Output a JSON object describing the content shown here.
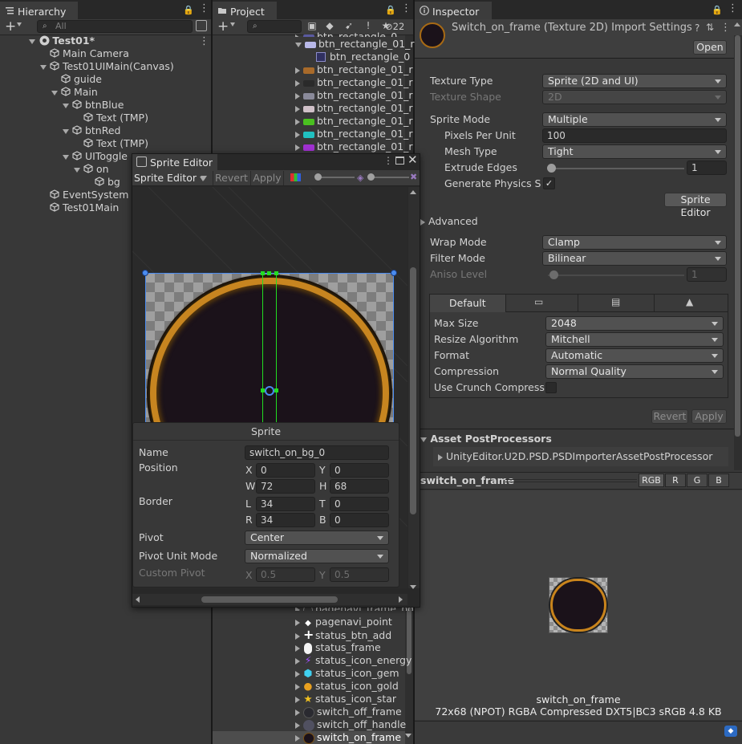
{
  "hierarchy": {
    "tab_label": "Hierarchy",
    "search_placeholder": "All",
    "items": [
      {
        "label": "Test01*"
      },
      {
        "label": "Main Camera"
      },
      {
        "label": "Test01UIMain(Canvas)"
      },
      {
        "label": "guide"
      },
      {
        "label": "Main"
      },
      {
        "label": "btnBlue"
      },
      {
        "label": "Text (TMP)"
      },
      {
        "label": "btnRed"
      },
      {
        "label": "Text (TMP)"
      },
      {
        "label": "UIToggle"
      },
      {
        "label": "on"
      },
      {
        "label": "bg"
      },
      {
        "label": "EventSystem"
      },
      {
        "label": "Test01Main"
      }
    ]
  },
  "project": {
    "tab_label": "Project",
    "hidden_count": "22",
    "top_items": [
      {
        "label": "btn_rectangle_0",
        "color": "#5a5aa0"
      },
      {
        "label": "btn_rectangle_01_r",
        "color": "#b8b8e8"
      },
      {
        "label": "btn_rectangle_0",
        "color": "#8080c0"
      },
      {
        "label": "btn_rectangle_01_r",
        "color": "#a86a2a"
      },
      {
        "label": "btn_rectangle_01_r",
        "color": "#2a2a2a"
      },
      {
        "label": "btn_rectangle_01_r",
        "color": "#8a8a9a"
      },
      {
        "label": "btn_rectangle_01_r",
        "color": "#d0c0c8"
      },
      {
        "label": "btn_rectangle_01_r",
        "color": "#4ac020"
      },
      {
        "label": "btn_rectangle_01_r",
        "color": "#20c0c0"
      },
      {
        "label": "btn_rectangle_01_r",
        "color": "#a030d0"
      }
    ],
    "bottom_items": [
      {
        "label": "pagenavi_frame_ng"
      },
      {
        "label": "pagenavi_point"
      },
      {
        "label": "status_btn_add"
      },
      {
        "label": "status_frame"
      },
      {
        "label": "status_icon_energy"
      },
      {
        "label": "status_icon_gem"
      },
      {
        "label": "status_icon_gold"
      },
      {
        "label": "status_icon_star"
      },
      {
        "label": "switch_off_frame"
      },
      {
        "label": "switch_off_handle"
      },
      {
        "label": "switch_on_frame"
      }
    ]
  },
  "sprite_editor": {
    "title": "Sprite Editor",
    "mode_label": "Sprite Editor",
    "revert": "Revert",
    "apply": "Apply",
    "sprite_panel": {
      "header": "Sprite",
      "name_label": "Name",
      "name_value": "switch_on_bg_0",
      "position_label": "Position",
      "x_label": "X",
      "x_value": "0",
      "y_label": "Y",
      "y_value": "0",
      "w_label": "W",
      "w_value": "72",
      "h_label": "H",
      "h_value": "68",
      "border_label": "Border",
      "l_label": "L",
      "l_value": "34",
      "t_label": "T",
      "t_value": "0",
      "r_label": "R",
      "r_value": "34",
      "b_label": "B",
      "b_value": "0",
      "pivot_label": "Pivot",
      "pivot_value": "Center",
      "pivot_unit_label": "Pivot Unit Mode",
      "pivot_unit_value": "Normalized",
      "custom_pivot_label": "Custom Pivot",
      "cx_label": "X",
      "cx_value": "0.5",
      "cy_label": "Y",
      "cy_value": "0.5"
    }
  },
  "inspector": {
    "tab_label": "Inspector",
    "title": "Switch_on_frame (Texture 2D) Import Settings",
    "open_button": "Open",
    "texture_type_label": "Texture Type",
    "texture_type_value": "Sprite (2D and UI)",
    "texture_shape_label": "Texture Shape",
    "texture_shape_value": "2D",
    "sprite_mode_label": "Sprite Mode",
    "sprite_mode_value": "Multiple",
    "ppu_label": "Pixels Per Unit",
    "ppu_value": "100",
    "mesh_type_label": "Mesh Type",
    "mesh_type_value": "Tight",
    "extrude_label": "Extrude Edges",
    "extrude_value": "1",
    "physics_label": "Generate Physics Sha",
    "sprite_editor_button": "Sprite Editor",
    "advanced_label": "Advanced",
    "wrap_label": "Wrap Mode",
    "wrap_value": "Clamp",
    "filter_label": "Filter Mode",
    "filter_value": "Bilinear",
    "aniso_label": "Aniso Level",
    "aniso_value": "1",
    "platform_default_tab": "Default",
    "max_size_label": "Max Size",
    "max_size_value": "2048",
    "resize_label": "Resize Algorithm",
    "resize_value": "Mitchell",
    "format_label": "Format",
    "format_value": "Automatic",
    "compression_label": "Compression",
    "compression_value": "Normal Quality",
    "crunch_label": "Use Crunch Compression",
    "revert_button": "Revert",
    "apply_button": "Apply",
    "postprocessors_label": "Asset PostProcessors",
    "postprocessor_item": "UnityEditor.U2D.PSD.PSDImporterAssetPostProcessor",
    "preview_name": "switch_on_frame",
    "channels": [
      "RGB",
      "R",
      "G",
      "B"
    ],
    "preview_caption": "switch_on_frame",
    "preview_info": "72x68 (NPOT)  RGBA Compressed DXT5|BC3 sRGB   4.8 KB"
  },
  "colors": {
    "accent_orange": "#d18a1c",
    "circle_fill": "#1b121a",
    "select_blue": "#2c5d87",
    "gizmo_green": "#22dd22",
    "gizmo_blue": "#4a8cf0"
  }
}
